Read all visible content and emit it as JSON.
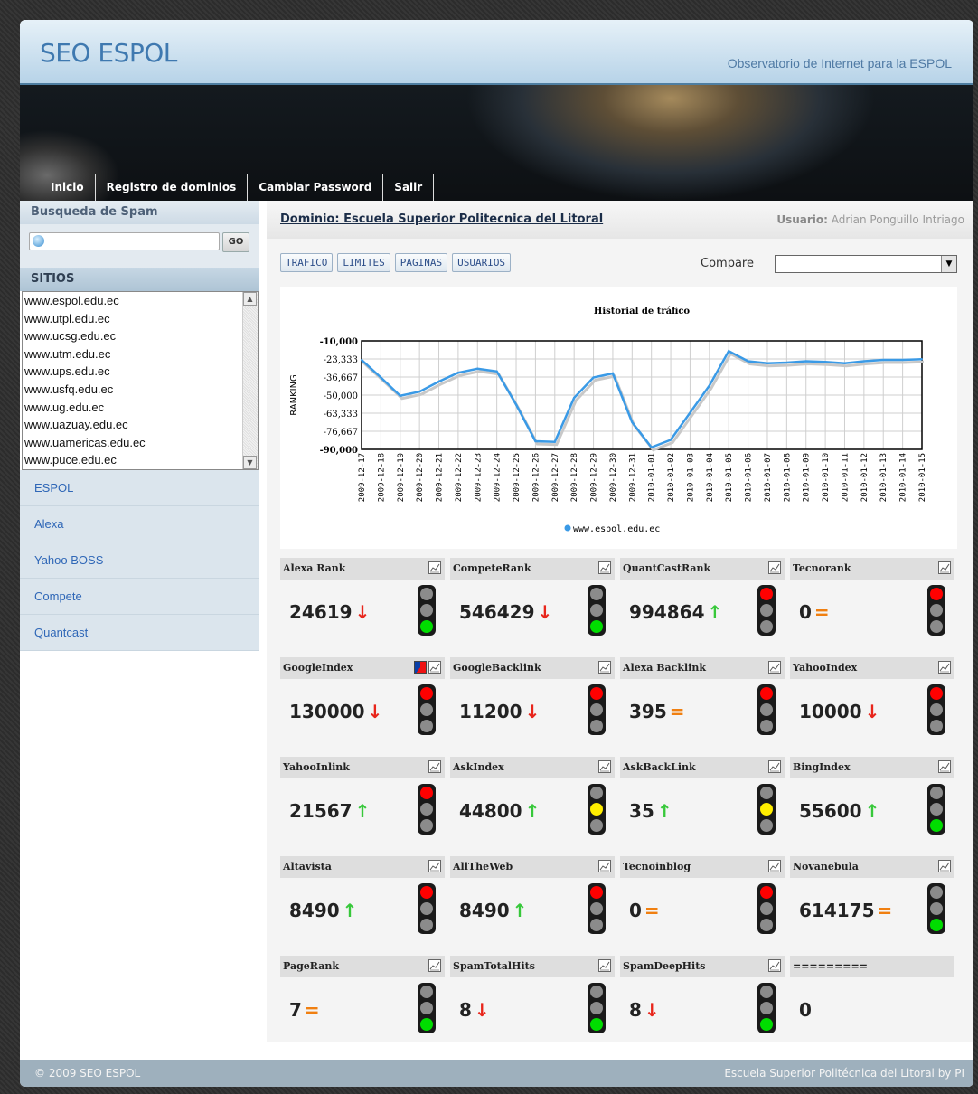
{
  "header": {
    "site_title": "SEO ESPOL",
    "slogan": "Observatorio de Internet para la ESPOL"
  },
  "nav": [
    "Inicio",
    "Registro de dominios",
    "Cambiar Password",
    "Salir"
  ],
  "sidebar": {
    "spam_title": "Busqueda de Spam",
    "go_label": "GO",
    "sitios_title": "SITIOS",
    "sites": [
      "www.espol.edu.ec",
      "www.utpl.edu.ec",
      "www.ucsg.edu.ec",
      "www.utm.edu.ec",
      "www.ups.edu.ec",
      "www.usfq.edu.ec",
      "www.ug.edu.ec",
      "www.uazuay.edu.ec",
      "www.uamericas.edu.ec",
      "www.puce.edu.ec"
    ],
    "links": [
      "ESPOL",
      "Alexa",
      "Yahoo BOSS",
      "Compete",
      "Quantcast"
    ]
  },
  "main": {
    "domain_title": "Dominio: Escuela Superior Politecnica del Litoral",
    "user_label": "Usuario:",
    "user_name": "Adrian Ponguillo Intriago",
    "tabs": [
      "TRAFICO",
      "LIMITES",
      "PAGINAS",
      "USUARIOS"
    ],
    "compare_label": "Compare",
    "compare_value": ""
  },
  "chart_data": {
    "type": "line",
    "title": "Historial de tráfico",
    "ylabel": "RANKING",
    "yticks": [
      "-10,000",
      "-23,333",
      "-36,667",
      "-50,000",
      "-63,333",
      "-76,667",
      "-90,000"
    ],
    "ylim": [
      -90000,
      -10000
    ],
    "x": [
      "2009-12-17",
      "2009-12-18",
      "2009-12-19",
      "2009-12-20",
      "2009-12-21",
      "2009-12-22",
      "2009-12-23",
      "2009-12-24",
      "2009-12-25",
      "2009-12-26",
      "2009-12-27",
      "2009-12-28",
      "2009-12-29",
      "2009-12-30",
      "2009-12-31",
      "2010-01-01",
      "2010-01-02",
      "2010-01-03",
      "2010-01-04",
      "2010-01-05",
      "2010-01-06",
      "2010-01-07",
      "2010-01-08",
      "2010-01-09",
      "2010-01-10",
      "2010-01-11",
      "2010-01-12",
      "2010-01-13",
      "2010-01-14",
      "2010-01-15"
    ],
    "series": [
      {
        "name": "www.espol.edu.ec",
        "color": "#3a9ae6",
        "values": [
          -24000,
          -37000,
          -50500,
          -47500,
          -40000,
          -33500,
          -30500,
          -32500,
          -57000,
          -84000,
          -84500,
          -52000,
          -37000,
          -34000,
          -70000,
          -88500,
          -83000,
          -63000,
          -43000,
          -17500,
          -25000,
          -26500,
          -26000,
          -25000,
          -25500,
          -26500,
          -25000,
          -24000,
          -24000,
          -23500
        ]
      }
    ],
    "grid": true,
    "legend_position": "bottom"
  },
  "metrics": [
    {
      "name": "Alexa Rank",
      "value": "24619",
      "trend": "down",
      "light": "green"
    },
    {
      "name": "CompeteRank",
      "value": "546429",
      "trend": "down",
      "light": "green"
    },
    {
      "name": "QuantCastRank",
      "value": "994864",
      "trend": "up",
      "light": "red"
    },
    {
      "name": "Tecnorank",
      "value": "0",
      "trend": "eq",
      "light": "red"
    },
    {
      "name": "GoogleIndex",
      "value": "130000",
      "trend": "down",
      "light": "red",
      "pie": true
    },
    {
      "name": "GoogleBacklink",
      "value": "11200",
      "trend": "down",
      "light": "red"
    },
    {
      "name": "Alexa Backlink",
      "value": "395",
      "trend": "eq",
      "light": "red"
    },
    {
      "name": "YahooIndex",
      "value": "10000",
      "trend": "down",
      "light": "red"
    },
    {
      "name": "YahooInlink",
      "value": "21567",
      "trend": "up",
      "light": "red"
    },
    {
      "name": "AskIndex",
      "value": "44800",
      "trend": "up",
      "light": "yellow"
    },
    {
      "name": "AskBackLink",
      "value": "35",
      "trend": "up",
      "light": "yellow"
    },
    {
      "name": "BingIndex",
      "value": "55600",
      "trend": "up",
      "light": "green"
    },
    {
      "name": "Altavista",
      "value": "8490",
      "trend": "up",
      "light": "red"
    },
    {
      "name": "AllTheWeb",
      "value": "8490",
      "trend": "up",
      "light": "red"
    },
    {
      "name": "Tecnoinblog",
      "value": "0",
      "trend": "eq",
      "light": "red"
    },
    {
      "name": "Novanebula",
      "value": "614175",
      "trend": "eq",
      "light": "green"
    },
    {
      "name": "PageRank",
      "value": "7",
      "trend": "eq",
      "light": "green"
    },
    {
      "name": "SpamTotalHits",
      "value": "8",
      "trend": "down",
      "light": "green"
    },
    {
      "name": "SpamDeepHits",
      "value": "8",
      "trend": "down",
      "light": "green"
    },
    {
      "name": "=========",
      "value": "0",
      "trend": "none",
      "light": "none",
      "noicon": true
    }
  ],
  "trend_glyphs": {
    "down": "↓",
    "up": "↑",
    "eq": "="
  },
  "light_colors": {
    "red": "#ff0000",
    "yellow": "#ffee00",
    "green": "#00dd00",
    "off": "#8b8b8b"
  },
  "footer": {
    "left": "© 2009 SEO ESPOL",
    "right": "Escuela Superior Politécnica del Litoral by PI"
  }
}
